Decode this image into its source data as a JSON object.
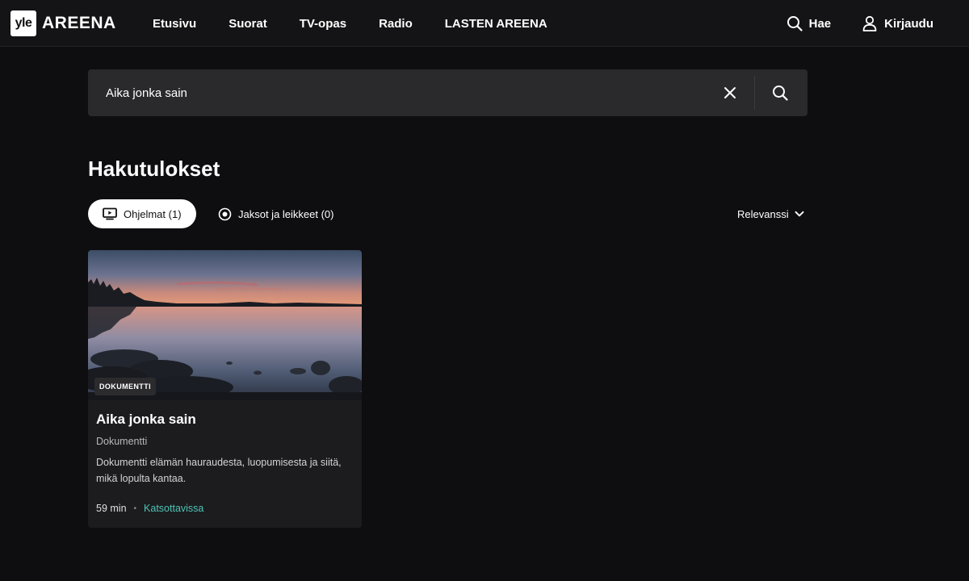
{
  "header": {
    "logo_yle": "yle",
    "logo_areena": "AREENA",
    "nav": [
      {
        "label": "Etusivu"
      },
      {
        "label": "Suorat"
      },
      {
        "label": "TV-opas"
      },
      {
        "label": "Radio"
      },
      {
        "label": "LASTEN AREENA"
      }
    ],
    "search_label": "Hae",
    "login_label": "Kirjaudu"
  },
  "search": {
    "value": "Aika jonka sain",
    "icons": {
      "clear": "close-icon",
      "submit": "search-icon"
    }
  },
  "results": {
    "title": "Hakutulokset",
    "filters": {
      "programs_label": "Ohjelmat (1)",
      "episodes_label": "Jaksot ja leikkeet (0)"
    },
    "sort_label": "Relevanssi"
  },
  "cards": [
    {
      "badge": "DOKUMENTTI",
      "title": "Aika jonka sain",
      "genre": "Dokumentti",
      "description": "Dokumentti elämän hauraudesta, luopumisesta ja siitä, mikä lopulta kantaa.",
      "duration": "59 min",
      "availability": "Katsottavissa"
    }
  ],
  "colors": {
    "background": "#0e0e10",
    "header": "#141416",
    "search_bg": "#2a2a2d",
    "card_bg": "#1c1c1f",
    "availability": "#4fc3b5"
  }
}
